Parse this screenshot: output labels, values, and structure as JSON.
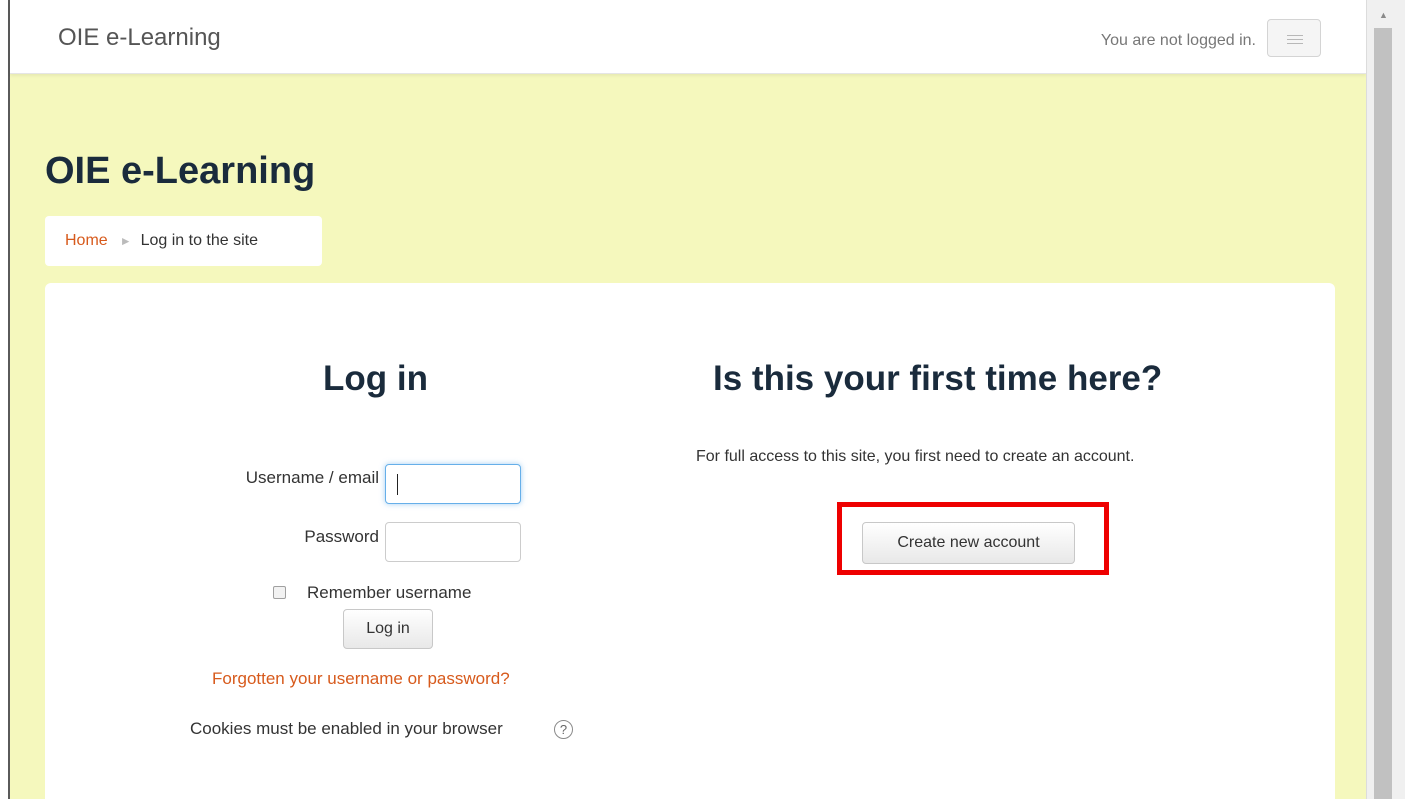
{
  "navbar": {
    "brand": "OIE e-Learning",
    "login_status": "You are not logged in.",
    "menu_icon": "hamburger-menu-icon"
  },
  "header": {
    "title": "OIE e-Learning"
  },
  "breadcrumb": {
    "home": "Home",
    "separator": "►",
    "current": "Log in to the site"
  },
  "login": {
    "title": "Log in",
    "username_label": "Username / email",
    "username_value": "",
    "password_label": "Password",
    "password_value": "",
    "remember_label": "Remember username",
    "remember_checked": false,
    "submit_label": "Log in",
    "forgot_link": "Forgotten your username or password?",
    "cookies_text": "Cookies must be enabled in your browser",
    "help_icon": "?"
  },
  "signup": {
    "title": "Is this your first time here?",
    "text": "For full access to this site, you first need to create an account.",
    "button_label": "Create new account"
  },
  "colors": {
    "page_background": "#f5f8bd",
    "link_accent": "#d75a1c",
    "heading": "#1a2b3c",
    "highlight": "#ee0000"
  }
}
